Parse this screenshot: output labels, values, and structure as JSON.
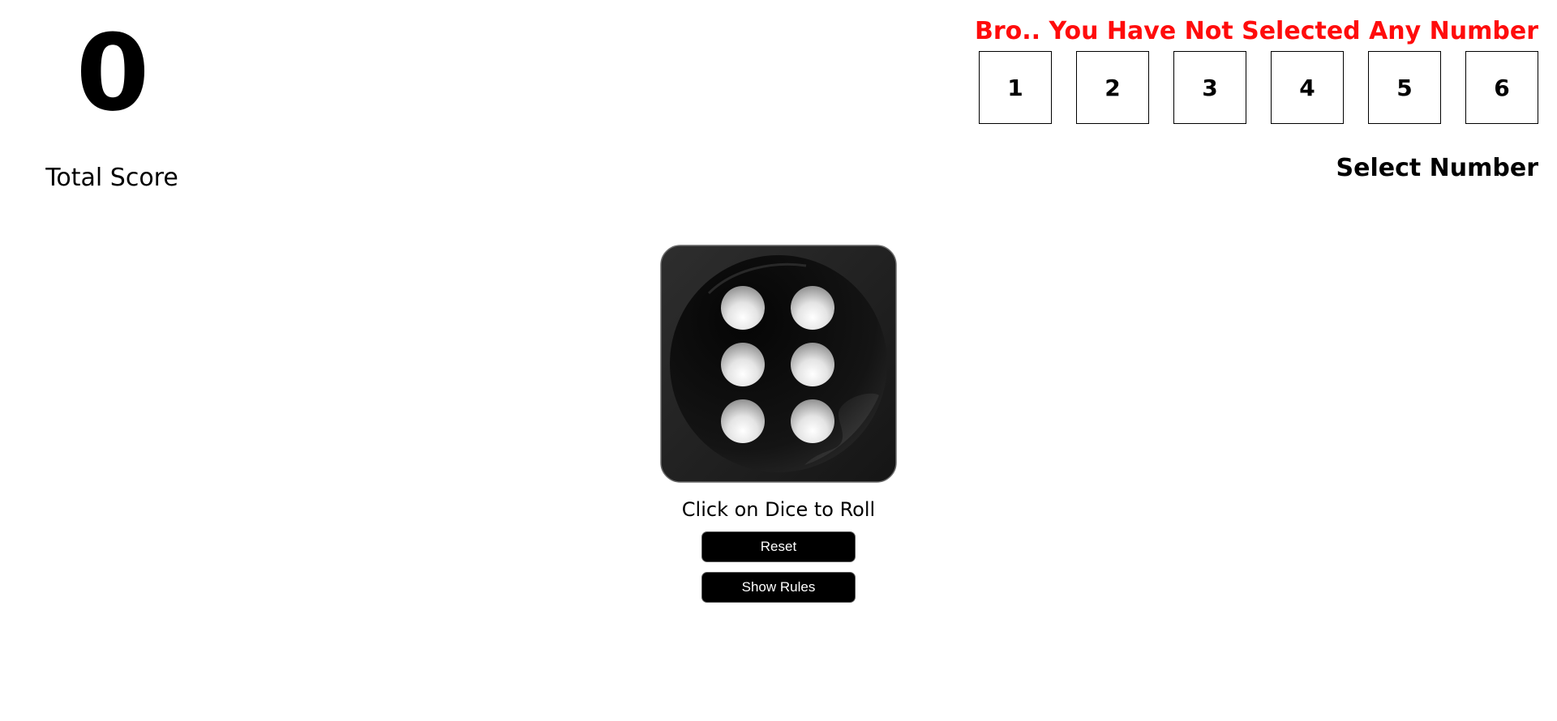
{
  "score": {
    "value": "0",
    "label": "Total Score"
  },
  "selection": {
    "error_message": "Bro.. You Have Not Selected Any Number",
    "numbers": [
      "1",
      "2",
      "3",
      "4",
      "5",
      "6"
    ],
    "label": "Select Number"
  },
  "dice": {
    "face_value": 6,
    "icon": "dice-six-icon",
    "instruction": "Click on Dice to Roll"
  },
  "buttons": {
    "reset_label": "Reset",
    "rules_label": "Show Rules"
  },
  "colors": {
    "error": "#ff0c0c",
    "button_bg": "#000000",
    "button_text": "#ffffff",
    "dice_body": "#1c1c1c"
  }
}
